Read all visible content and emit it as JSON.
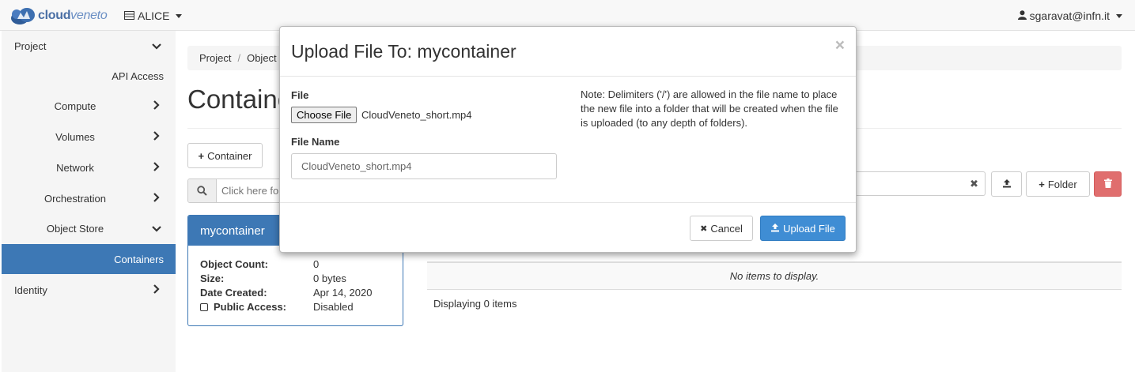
{
  "navbar": {
    "brand_text": "cloud",
    "brand_text_suffix": "veneto",
    "project": "ALICE",
    "user": "sgaravat@infn.it"
  },
  "sidebar": {
    "items": [
      {
        "label": "Project"
      },
      {
        "label": "API Access"
      },
      {
        "label": "Compute"
      },
      {
        "label": "Volumes"
      },
      {
        "label": "Network"
      },
      {
        "label": "Orchestration"
      },
      {
        "label": "Object Store"
      },
      {
        "label": "Containers"
      },
      {
        "label": "Identity"
      }
    ]
  },
  "breadcrumb": {
    "items": [
      "Project",
      "Object Store"
    ]
  },
  "page": {
    "title": "Containers"
  },
  "toolbar": {
    "container_button": "Container",
    "folder_button": "Folder",
    "search_placeholder": "Click here for filters."
  },
  "container": {
    "name": "mycontainer",
    "object_count_label": "Object Count:",
    "object_count": "0",
    "size_label": "Size:",
    "size": "0 bytes",
    "date_created_label": "Date Created:",
    "date_created": "Apr 14, 2020",
    "public_access_label": "Public Access:",
    "public_access": "Disabled"
  },
  "table": {
    "empty_text": "No items to display.",
    "footer": "Displaying 0 items"
  },
  "modal": {
    "title": "Upload File To: mycontainer",
    "close": "×",
    "file_label": "File",
    "choose_file_button": "Choose File",
    "chosen_file": "CloudVeneto_short.mp4",
    "file_name_label": "File Name",
    "file_name_value": "CloudVeneto_short.mp4",
    "note": "Note: Delimiters ('/') are allowed in the file name to place the new file into a folder that will be created when the file is uploaded (to any depth of folders).",
    "cancel_button": "Cancel",
    "upload_button": "Upload File"
  },
  "colors": {
    "primary": "#3d78b5",
    "primary_button": "#3f8dd4",
    "danger": "#e06e6e"
  }
}
